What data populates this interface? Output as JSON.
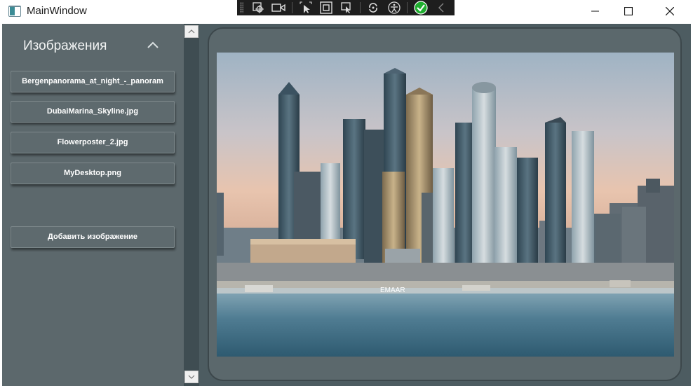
{
  "window": {
    "title": "MainWindow"
  },
  "toolbar": {
    "tools": [
      "select-element-icon",
      "video-icon",
      "pointer-icon",
      "frame-icon",
      "element-pick-icon",
      "refresh-icon",
      "accessibility-icon",
      "check-icon",
      "chevron-left-icon"
    ]
  },
  "sidebar": {
    "title": "Изображения",
    "images": [
      "Bergenpanorama_at_night_-_panoram",
      "DubaiMarina_Skyline.jpg",
      "Flowerposter_2.jpg",
      "MyDesktop.png"
    ],
    "add_label": "Добавить изображение"
  },
  "viewer": {
    "photo_text": "EMAAR"
  },
  "colors": {
    "sidebar": "#5c686c",
    "content": "#4d5c61",
    "card": "#5b686c",
    "scrollbar": "#3f4d52"
  }
}
